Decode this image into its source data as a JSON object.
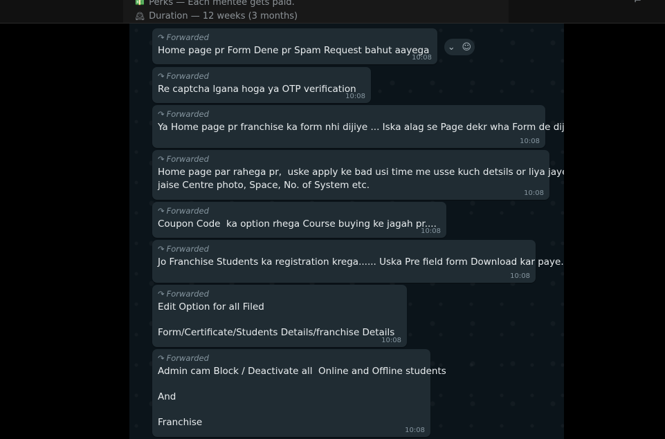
{
  "snippet": {
    "lines": [
      {
        "icon": "💵",
        "text": "Perks — Each mentee gets paid."
      },
      {
        "icon": "🕰",
        "text": "Duration — 12 weeks (3 months)"
      }
    ]
  },
  "forward_label": "Forwarded",
  "messages": [
    {
      "text": "Home page pr Form Dene pr Spam Request bahut aayega",
      "time": "10:08"
    },
    {
      "text": "Re captcha lgana hoga ya OTP verification",
      "time": "10:08"
    },
    {
      "text": "Ya Home page pr franchise ka form nhi dijiye ... Iska alag se Page dekr wha Form de dijiye",
      "time": "10:08"
    },
    {
      "text": "Home page par rahega pr,  uske apply ke bad usi time me usse kuch detsils or liya jayega ,\njaise Centre photo, Space, No. of System etc.",
      "time": "10:08"
    },
    {
      "text": "Coupon Code  ka option rhega Course buying ke jagah pr....",
      "time": "10:08"
    },
    {
      "text": "Jo Franchise Students ka registration krega...... Uska Pre field form Download kar paye...",
      "time": "10:08"
    },
    {
      "text": "Edit Option for all Filed\n\nForm/Certificate/Students Details/franchise Details",
      "time": "10:08"
    },
    {
      "text": "Admin cam Block / Deactivate all  Online and Offline students\n\nAnd\n\nFranchise",
      "time": "10:08"
    }
  ],
  "hover_actions": {
    "chevron": "⌄",
    "emoji": "☺"
  },
  "colors": {
    "bubble": "#202c33",
    "chat_bg": "#0b141a",
    "meta_text": "#8696a0"
  }
}
